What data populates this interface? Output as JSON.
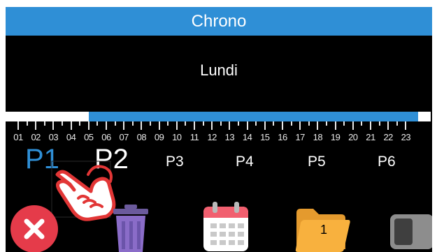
{
  "header": {
    "title": "Chrono"
  },
  "day": {
    "label": "Lundi"
  },
  "timeline": {
    "hours": [
      "01",
      "02",
      "03",
      "04",
      "05",
      "06",
      "07",
      "08",
      "09",
      "10",
      "11",
      "12",
      "13",
      "14",
      "15",
      "16",
      "17",
      "18",
      "19",
      "20",
      "21",
      "22",
      "23"
    ],
    "selected_start_hour": "06",
    "selected_end_hour": "23",
    "range_color": "#2f8fd6"
  },
  "programs": {
    "tabs": [
      "P1",
      "P2",
      "P3",
      "P4",
      "P5",
      "P6"
    ],
    "active": "P1"
  },
  "actions": {
    "folder_badge": "1",
    "icons": [
      "close-icon",
      "trash-icon",
      "calendar-icon",
      "folder-icon",
      "toggle-switch"
    ]
  },
  "colors": {
    "accent": "#2f8fd6",
    "close": "#e53b4a",
    "trash": "#8a6cc8",
    "calendar": "#f15f6f",
    "folder": "#f8b13e"
  }
}
